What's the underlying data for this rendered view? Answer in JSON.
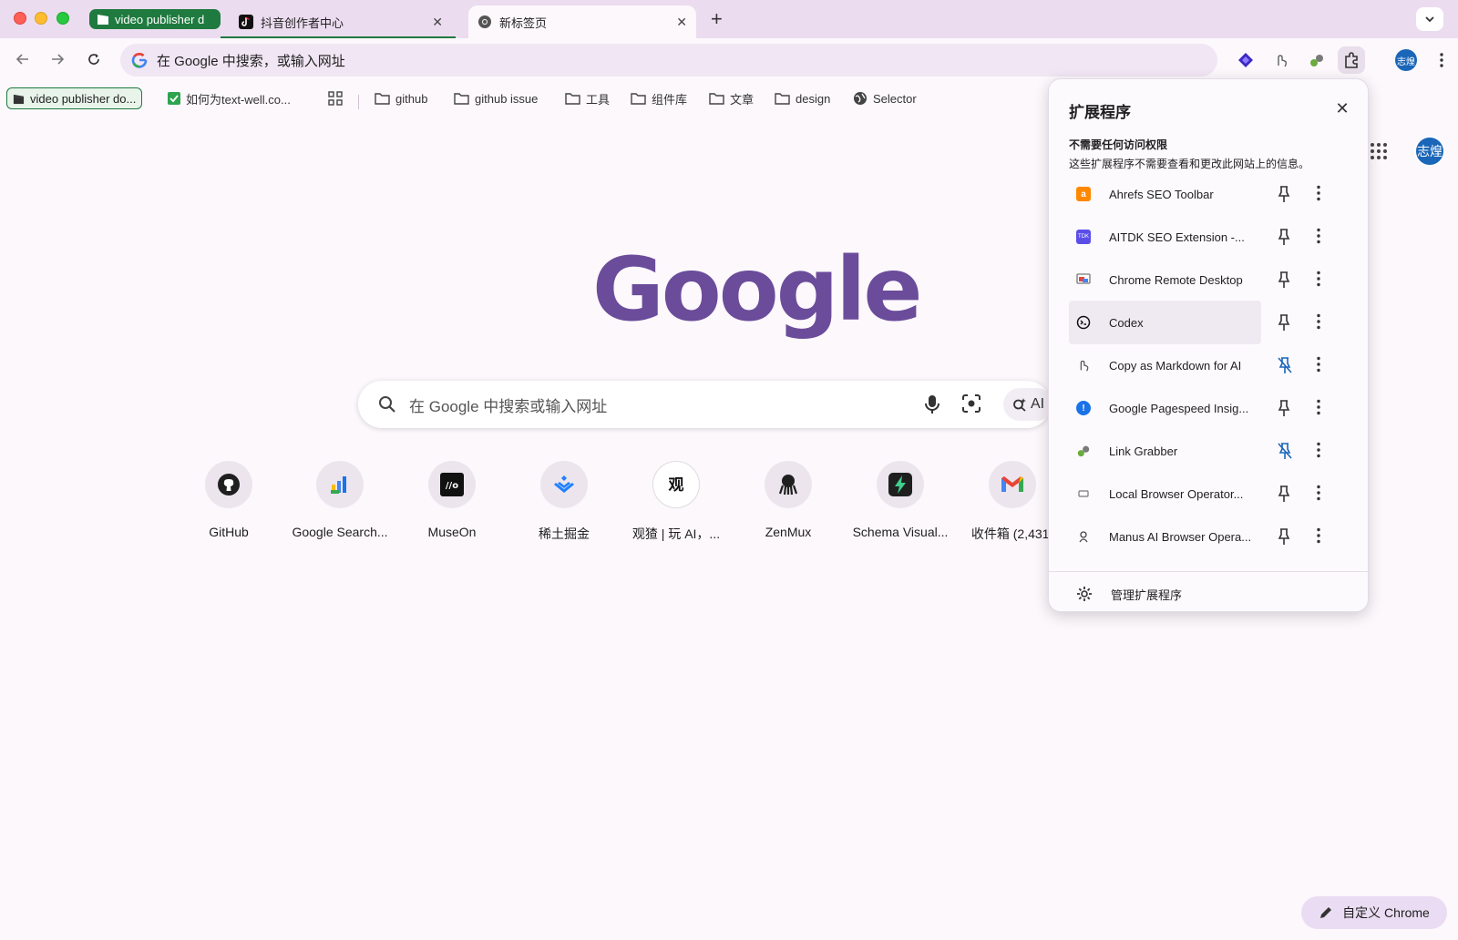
{
  "tabs": {
    "group_label": "video publisher d",
    "douyin_title": "抖音创作者中心",
    "newtab_title": "新标签页"
  },
  "omnibox": {
    "text": "在 Google 中搜索，或输入网址"
  },
  "bookmarks": [
    "video publisher do...",
    "如何为text-well.co...",
    "github",
    "github issue",
    "工具",
    "组件库",
    "文章",
    "design",
    "Selector"
  ],
  "profile": {
    "initials": "志煌"
  },
  "search": {
    "placeholder": "在 Google 中搜索或输入网址",
    "ai_label": "AI"
  },
  "shortcuts": [
    {
      "label": "GitHub"
    },
    {
      "label": "Google Search..."
    },
    {
      "label": "MuseOn"
    },
    {
      "label": "稀土掘金"
    },
    {
      "label": "观猹 | 玩 AI，..."
    },
    {
      "label": "ZenMux"
    },
    {
      "label": "Schema Visual..."
    },
    {
      "label": "收件箱 (2,431)"
    }
  ],
  "extensions_panel": {
    "title": "扩展程序",
    "subheading": "不需要任何访问权限",
    "description": "这些扩展程序不需要查看和更改此网站上的信息。",
    "items": [
      {
        "name": "Ahrefs SEO Toolbar",
        "pinned": false
      },
      {
        "name": "AITDK SEO Extension -...",
        "pinned": false
      },
      {
        "name": "Chrome Remote Desktop",
        "pinned": false
      },
      {
        "name": "Codex",
        "pinned": false
      },
      {
        "name": "Copy as Markdown for AI",
        "pinned": true
      },
      {
        "name": "Google Pagespeed Insig...",
        "pinned": false
      },
      {
        "name": "Link Grabber",
        "pinned": true
      },
      {
        "name": "Local Browser Operator...",
        "pinned": false
      },
      {
        "name": "Manus AI Browser Opera...",
        "pinned": false
      }
    ],
    "manage_label": "管理扩展程序"
  },
  "customize": {
    "label": "自定义 Chrome"
  },
  "colors": {
    "accent_purple": "#6b4c9a",
    "tab_group_green": "#1f7a3f",
    "pinned_blue": "#1a66b8",
    "tabstrip_bg": "#ecdcf0"
  }
}
